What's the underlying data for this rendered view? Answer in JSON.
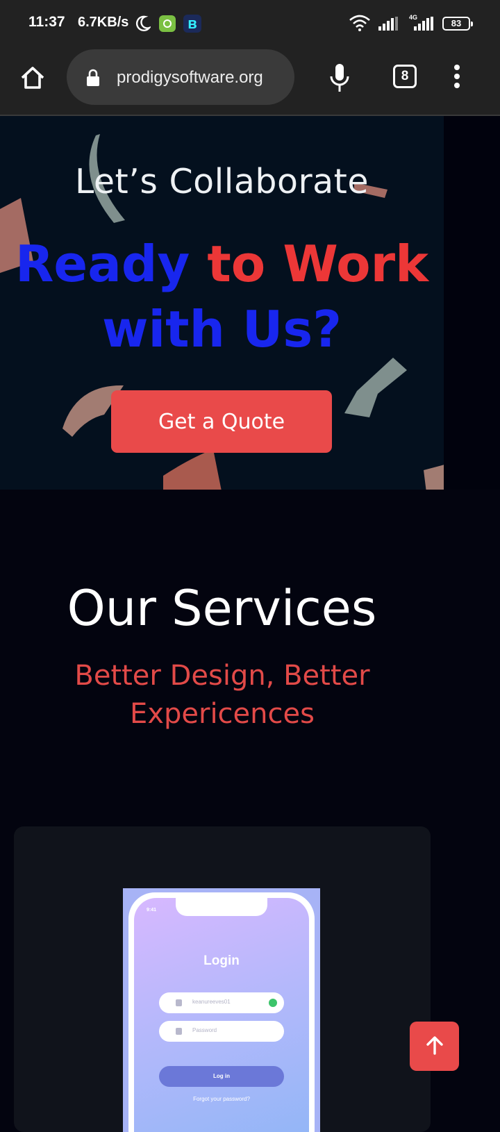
{
  "status_bar": {
    "time": "11:37",
    "net_speed": "6.7KB/s",
    "network_type": "4G",
    "battery": "83",
    "icons": [
      "moon-icon",
      "app-notification-icon",
      "app-b-icon",
      "wifi-icon",
      "signal-icon",
      "signal-icon",
      "battery-icon"
    ]
  },
  "browser": {
    "url": "prodigysoftware.org",
    "tab_count": "8",
    "icons": [
      "home-icon",
      "lock-icon",
      "microphone-icon",
      "tabs-icon",
      "more-vert-icon"
    ]
  },
  "hero": {
    "subtitle": "Let’s Collaborate",
    "title_part1": "Ready ",
    "title_part2": "to Work",
    "title_part3": "with Us?",
    "cta_label": "Get a Quote",
    "colors": {
      "blue": "#1826ee",
      "red": "#ec3737",
      "button": "#e94a4a"
    }
  },
  "services": {
    "title": "Our Services",
    "subtitle": "Better Design, Better Expericences"
  },
  "card_mockup": {
    "phone_time": "9:41",
    "login_title": "Login",
    "username_value": "keanureeves01",
    "password_placeholder": "Password",
    "login_button": "Log in",
    "forgot_link": "Forgot your password?"
  },
  "scroll_top": {
    "icon": "arrow-up-icon"
  }
}
